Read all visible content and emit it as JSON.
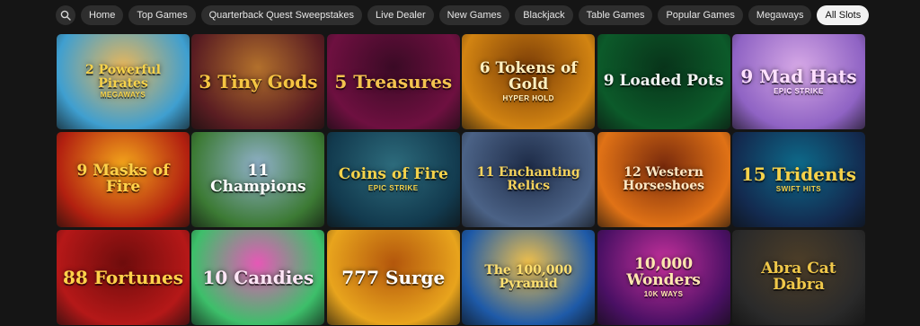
{
  "filters": {
    "search_icon": "search-icon",
    "chips": [
      {
        "label": "Home",
        "active": false
      },
      {
        "label": "Top Games",
        "active": false
      },
      {
        "label": "Quarterback Quest Sweepstakes",
        "active": false
      },
      {
        "label": "Live Dealer",
        "active": false
      },
      {
        "label": "New Games",
        "active": false
      },
      {
        "label": "Blackjack",
        "active": false
      },
      {
        "label": "Table Games",
        "active": false
      },
      {
        "label": "Popular Games",
        "active": false
      },
      {
        "label": "Megaways",
        "active": false
      },
      {
        "label": "All Slots",
        "active": true
      }
    ]
  },
  "games": [
    {
      "title": "2 Powerful Pirates",
      "sub": "MEGAWAYS",
      "bg": "#3f9fd0",
      "bg2": "#e8b65a",
      "color": "#f6d24a"
    },
    {
      "title": "3 Tiny Gods",
      "sub": "",
      "bg": "#5a1d22",
      "bg2": "#b2702c",
      "color": "#f5c542"
    },
    {
      "title": "5 Treasures",
      "sub": "",
      "bg": "#6e1040",
      "bg2": "#3a0a25",
      "color": "#f3c34f"
    },
    {
      "title": "6 Tokens of Gold",
      "sub": "HYPER HOLD",
      "bg": "#d28412",
      "bg2": "#7b3d07",
      "color": "#fff0c0"
    },
    {
      "title": "9 Loaded Pots",
      "sub": "",
      "bg": "#0c5a2a",
      "bg2": "#08341a",
      "color": "#f1f1f1"
    },
    {
      "title": "9 Mad Hats",
      "sub": "EPIC STRIKE",
      "bg": "#8f63c4",
      "bg2": "#d6a8e6",
      "color": "#ffe0ff"
    },
    {
      "title": "9 Masks of Fire",
      "sub": "",
      "bg": "#b22010",
      "bg2": "#f3a51b",
      "color": "#ffd24a"
    },
    {
      "title": "11 Champions",
      "sub": "",
      "bg": "#3c7a34",
      "bg2": "#8fb0c8",
      "color": "#ffffff"
    },
    {
      "title": "Coins of Fire",
      "sub": "EPIC STRIKE",
      "bg": "#123a4e",
      "bg2": "#2d6b7c",
      "color": "#f5d24a"
    },
    {
      "title": "11 Enchanting Relics",
      "sub": "",
      "bg": "#4b6286",
      "bg2": "#1e2c48",
      "color": "#f6d35c"
    },
    {
      "title": "12 Western Horseshoes",
      "sub": "",
      "bg": "#e07216",
      "bg2": "#7a2b0c",
      "color": "#ffe8c4"
    },
    {
      "title": "15 Tridents",
      "sub": "SWIFT HITS",
      "bg": "#132a4f",
      "bg2": "#0d6a8a",
      "color": "#f6d24a"
    },
    {
      "title": "88 Fortunes",
      "sub": "",
      "bg": "#b51818",
      "bg2": "#6e0c0c",
      "color": "#ffd24a"
    },
    {
      "title": "10 Candies",
      "sub": "",
      "bg": "#3dbf6a",
      "bg2": "#e658b6",
      "color": "#ffe6f6"
    },
    {
      "title": "777 Surge",
      "sub": "",
      "bg": "#e8a41d",
      "bg2": "#b3560c",
      "color": "#ffffff"
    },
    {
      "title": "The 100,000 Pyramid",
      "sub": "",
      "bg": "#1e5aa8",
      "bg2": "#f0c04b",
      "color": "#ffe070"
    },
    {
      "title": "10,000 Wonders",
      "sub": "10K WAYS",
      "bg": "#4a1064",
      "bg2": "#c6319c",
      "color": "#ffe6b0"
    },
    {
      "title": "Abra Cat Dabra",
      "sub": "",
      "bg": "#2a2a2a",
      "bg2": "#4d3e28",
      "color": "#f0c84a"
    }
  ]
}
